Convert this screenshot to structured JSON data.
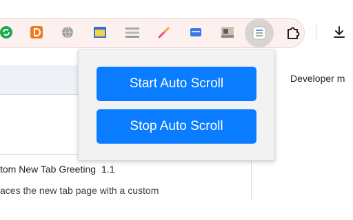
{
  "colors": {
    "accent_button": "#0a7cff",
    "toolbar_strip": "#fdf1ef",
    "popup_bg": "#f2f2f2"
  },
  "toolbar": {
    "extension_icons": [
      "sync-icon",
      "orange-d-icon",
      "globe-icon",
      "window-icon",
      "stripes-icon",
      "pipette-icon",
      "cards-icon",
      "photo-icon",
      "auto-scroll-icon",
      "puzzle-icon",
      "download-icon"
    ]
  },
  "popup": {
    "start_label": "Start Auto Scroll",
    "stop_label": "Stop Auto Scroll"
  },
  "page": {
    "developer_mode_label": "Developer m",
    "extension_card": {
      "title": "tom New Tab Greeting",
      "version": "1.1",
      "description": "aces the new tab page with a custom"
    }
  }
}
